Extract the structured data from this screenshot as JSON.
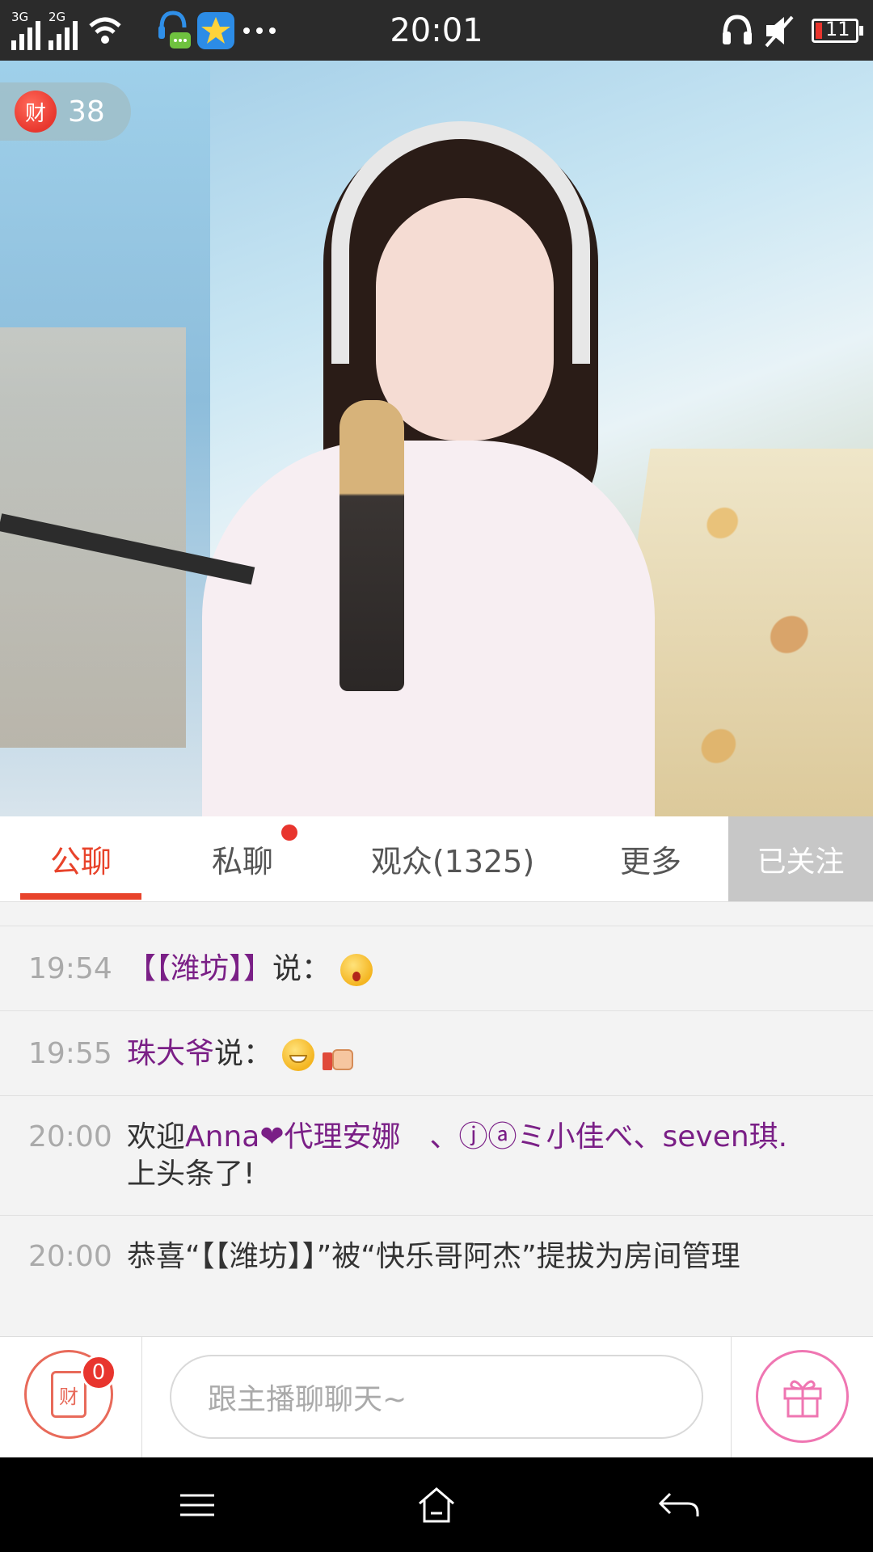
{
  "status_bar": {
    "sig1_label": "3G",
    "sig2_label": "2G",
    "time": "20:01",
    "battery": "11"
  },
  "video": {
    "coin_badge_label": "财",
    "coin_count": "38"
  },
  "tabs": {
    "public_chat": "公聊",
    "private_chat": "私聊",
    "audience": "观众(1325)",
    "more": "更多",
    "follow_button": "已关注"
  },
  "chat": [
    {
      "time": "19:54",
      "user": "【【潍坊】】",
      "said": "说：",
      "emojis": [
        "shocked"
      ]
    },
    {
      "time": "19:55",
      "user": "珠大爷",
      "said": "说：",
      "emojis": [
        "grin",
        "thumbs-up"
      ]
    },
    {
      "time": "20:00",
      "prefix": "欢迎",
      "names": "Anna❤代理安娜　、ⓙⓐミ小佳べ、seven琪.",
      "suffix": "上头条了!"
    },
    {
      "time": "20:00",
      "text": "恭喜“【【潍坊】】”被“快乐哥阿杰”提拔为房间管理"
    }
  ],
  "bottom": {
    "redpack_label": "财",
    "redpack_badge": "0",
    "input_placeholder": "跟主播聊聊天~"
  },
  "colors": {
    "accent": "#e8432b",
    "username": "#7a1f86",
    "follow_bg": "#c7c7c7",
    "gift_pink": "#ef76b2"
  },
  "icons": [
    "signal-icon",
    "wifi-icon",
    "chat-notification-icon",
    "app-star-icon",
    "more-dots-icon",
    "headphones-icon",
    "mute-icon",
    "battery-icon",
    "gift-icon",
    "menu-icon",
    "home-icon",
    "back-icon"
  ]
}
